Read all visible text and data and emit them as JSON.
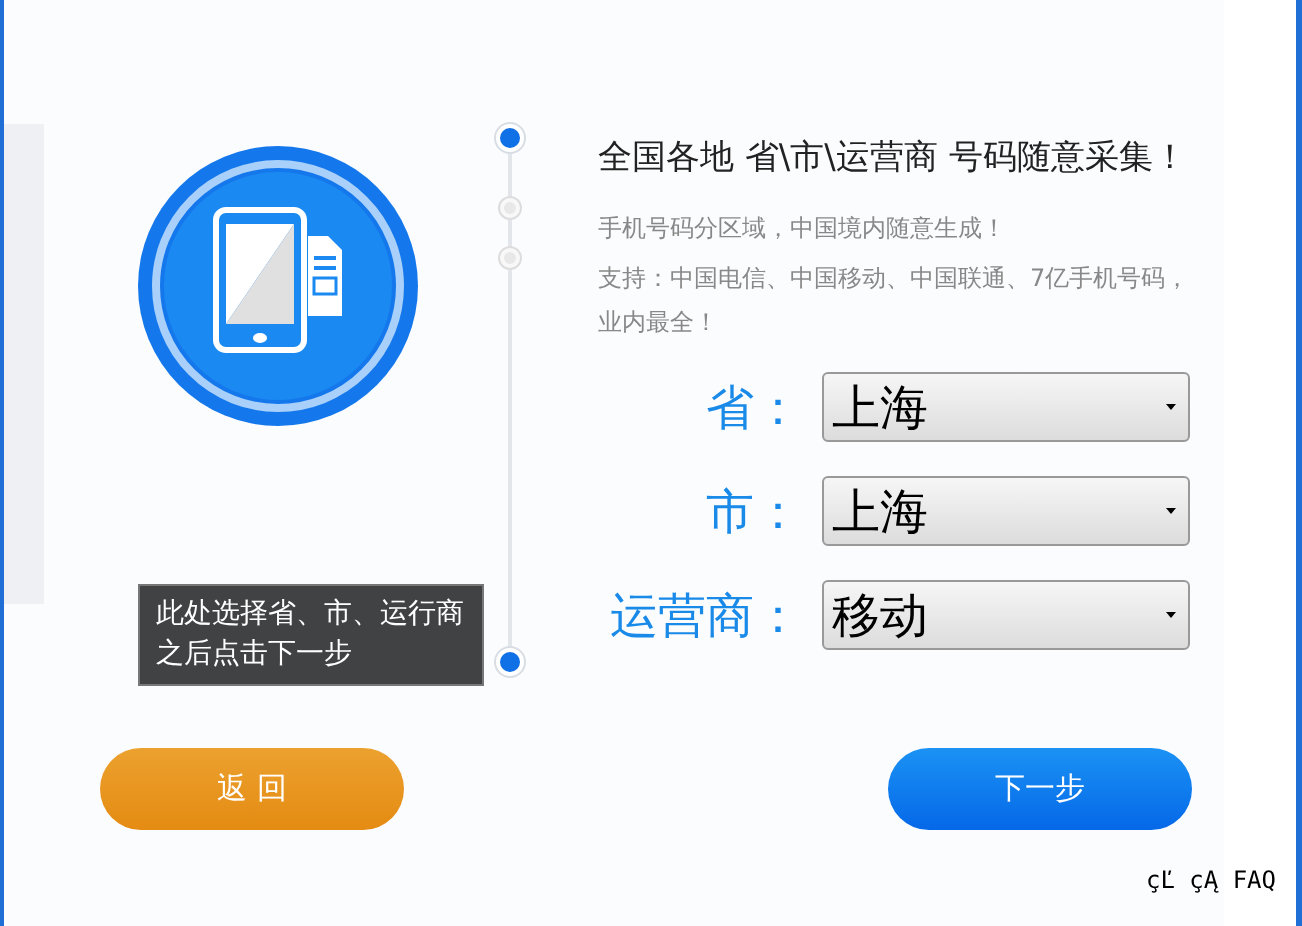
{
  "headline": "全国各地 省\\市\\运营商 号码随意采集！",
  "notes": [
    "手机号码分区域，中国境内随意生成！",
    "支持：中国电信、中国移动、中国联通、7亿手机号码，业内最全！"
  ],
  "timeline": [
    {
      "active": true
    },
    {
      "active": false
    },
    {
      "active": false
    },
    {
      "active": true
    }
  ],
  "fields": [
    {
      "label": "省：",
      "value": "上海"
    },
    {
      "label": "市：",
      "value": "上海"
    },
    {
      "label": "运营商：",
      "value": "移动"
    }
  ],
  "tooltip": "此处选择省、市、运行商之后点击下一步",
  "buttons": [
    {
      "kind": "back",
      "label": "返 回"
    },
    {
      "kind": "next",
      "label": "下一步"
    }
  ],
  "footer_link": "çĽ çĄ FAQ"
}
